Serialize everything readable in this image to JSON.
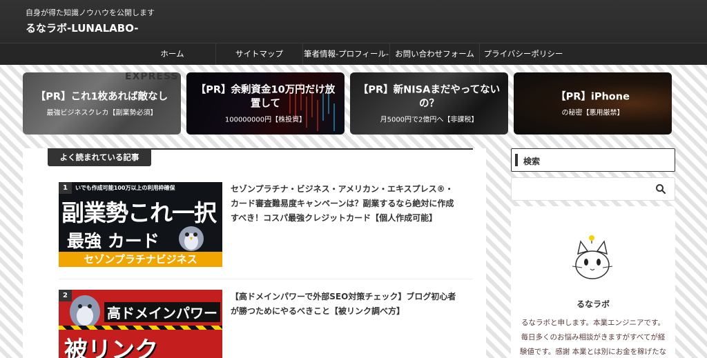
{
  "header": {
    "tagline": "自身が得た知識ノウハウを公開します",
    "site_title": "るなラボ-LUNALABO-"
  },
  "nav": {
    "items": [
      {
        "label": "ホーム"
      },
      {
        "label": "サイトマップ"
      },
      {
        "label": "筆者情報-プロフィール-"
      },
      {
        "label": "お問い合わせフォーム"
      },
      {
        "label": "プライバシーポリシー"
      }
    ]
  },
  "carousel": {
    "cards": [
      {
        "title": "【PR】これ1枚あれば敵なし",
        "subtitle": "最強ビジネスクレカ【副業勢必須】",
        "bg_text": "EXPRESS"
      },
      {
        "title": "【PR】余剰資金10万円だけ放置して",
        "subtitle": "100000000円【株投資】"
      },
      {
        "title": "【PR】新NISAまだやってないの？",
        "subtitle": "月5000円で2億円へ【非課税】"
      },
      {
        "title": "【PR】iPhone",
        "subtitle": "の秘密【悪用厳禁】"
      }
    ]
  },
  "popular": {
    "heading": "よく読まれている記事",
    "articles": [
      {
        "rank": "1",
        "title": "セゾンプラチナ・ビジネス・アメリカン・エキスプレス®・カード審査難易度キャンペーンは？副業するなら絶対に作成すべき！コスパ最強クレジットカード【個人作成可能】",
        "thumb_top": "いでも作成可能100万以上の利用枠確保",
        "thumb_main": "副業勢これ一択",
        "thumb_mid": "最強 カード",
        "thumb_bottom": "セゾンプラチナビジネス"
      },
      {
        "rank": "2",
        "title": "【高ドメインパワーで外部SEO対策チェック】ブログ初心者が勝つためにやるべきこと【被リンク調べ方】",
        "thumb_top": "高ドメインパワー",
        "thumb_main": "被リンク"
      }
    ]
  },
  "sidebar": {
    "search_heading": "検索",
    "search_placeholder": "",
    "profile_name": "るなラボ",
    "profile_bio": "るなラボと申します。本業エンジニアです。毎日多くのお悩み相談がきますがすべてが経験値です。感謝 本業とは別にお金を稼げたな"
  },
  "colors": {
    "header_bg": "#2c2c2c",
    "nav_bg": "#262626",
    "accent_dark": "#333333",
    "thumb_bottom_band": "#f0a500",
    "thumb2_bg": "#c41e1e"
  },
  "icons": [
    "search-icon",
    "cat-avatar-icon"
  ]
}
